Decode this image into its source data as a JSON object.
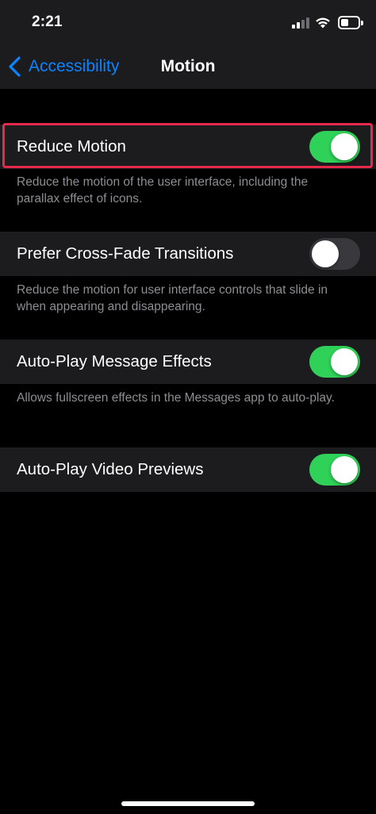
{
  "status_bar": {
    "time": "2:21",
    "icons": [
      "cellular-signal-icon",
      "wifi-icon",
      "battery-icon"
    ]
  },
  "nav": {
    "back_label": "Accessibility",
    "title": "Motion"
  },
  "settings": [
    {
      "label": "Reduce Motion",
      "enabled": true,
      "footer": "Reduce the motion of the user interface, including the parallax effect of icons."
    },
    {
      "label": "Prefer Cross-Fade Transitions",
      "enabled": false,
      "footer": "Reduce the motion for user interface controls that slide in when appearing and disappearing."
    },
    {
      "label": "Auto-Play Message Effects",
      "enabled": true,
      "footer": "Allows fullscreen effects in the Messages app to auto-play."
    },
    {
      "label": "Auto-Play Video Previews",
      "enabled": true,
      "footer": ""
    }
  ],
  "colors": {
    "accent": "#0a84ff",
    "toggle_on": "#30d158",
    "toggle_off": "#39393d",
    "highlight": "#e8294e",
    "cell_background": "#1c1c1e",
    "footer_text": "#8d8d93"
  }
}
